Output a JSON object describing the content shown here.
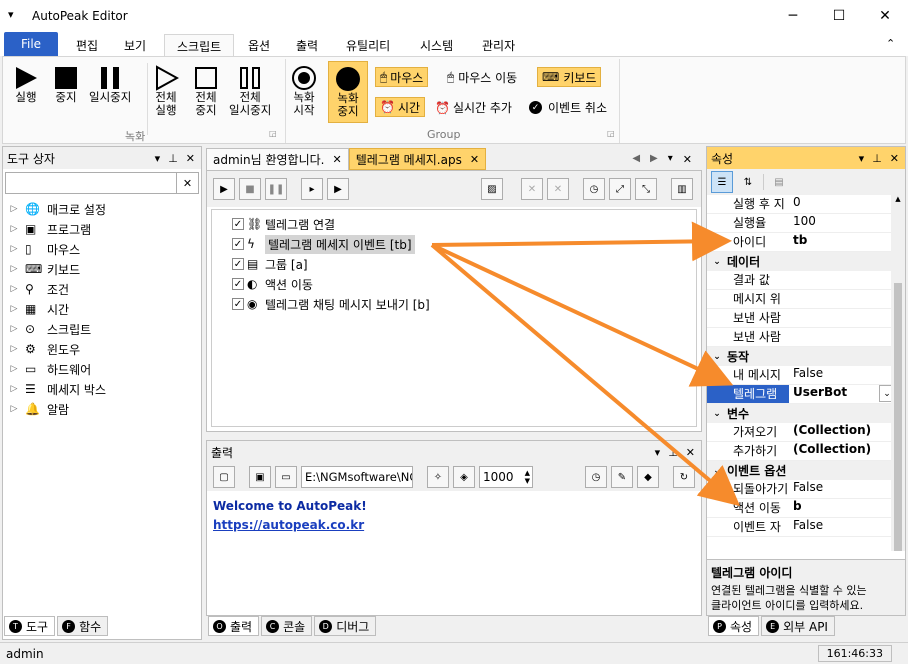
{
  "app": {
    "title": "AutoPeak Editor"
  },
  "menu": {
    "file": "File",
    "tabs": [
      "편집",
      "보기",
      "스크립트",
      "옵션",
      "출력",
      "유틸리티",
      "시스템",
      "관리자"
    ]
  },
  "ribbon": {
    "run": "실행",
    "stop": "중지",
    "pause": "일시중지",
    "full_run_1": "전체",
    "full_run_2": "실행",
    "full_stop_1": "전체",
    "full_stop_2": "중지",
    "full_pause_1": "전체",
    "full_pause_2": "일시중지",
    "group1": "녹화",
    "rec_start_1": "녹화",
    "rec_start_2": "시작",
    "rec_stop_1": "녹화",
    "rec_stop_2": "중지",
    "mouse": "마우스",
    "mouse_move": "마우스 이동",
    "keyboard": "키보드",
    "time": "시간",
    "realtime_add": "실시간 추가",
    "event_cancel": "이벤트 취소",
    "group2": "Group"
  },
  "toolbox": {
    "title": "도구 상자",
    "items": [
      "매크로 설정",
      "프로그램",
      "마우스",
      "키보드",
      "조건",
      "시간",
      "스크립트",
      "윈도우",
      "하드웨어",
      "메세지 박스",
      "알람"
    ],
    "tab_tool": "도구",
    "tab_func": "함수",
    "tab_tool_key": "T",
    "tab_func_key": "F"
  },
  "editor": {
    "tab1": "admin님 환영합니다.",
    "tab2": "텔레그램 메세지.aps",
    "items": [
      {
        "label": "텔레그램 연결",
        "icon": "link-icon"
      },
      {
        "label": "텔레그램 메세지 이벤트 [tb]",
        "icon": "lightning-icon"
      },
      {
        "label": "그룹 [a]",
        "icon": "group-icon"
      },
      {
        "label": "액션 이동",
        "icon": "action-icon"
      },
      {
        "label": "텔레그램 채팅 메시지 보내기 [b]",
        "icon": "telegram-icon"
      }
    ]
  },
  "output": {
    "title": "출력",
    "path": "E:\\NGMsoftware\\NG",
    "count": "1000",
    "line1": "Welcome to AutoPeak!",
    "line2": "https://autopeak.co.kr",
    "tab_out": "출력",
    "tab_console": "콘솔",
    "tab_debug": "디버그",
    "key_out": "O",
    "key_console": "C",
    "key_debug": "D"
  },
  "properties": {
    "title": "속성",
    "rows_top": [
      {
        "name": "실행 후 지",
        "value": "0"
      },
      {
        "name": "실행율",
        "value": "100"
      },
      {
        "name": "아이디",
        "value": "tb"
      }
    ],
    "cat_data": "데이터",
    "rows_data": [
      {
        "name": "결과 값",
        "value": ""
      },
      {
        "name": "메시지 위",
        "value": ""
      },
      {
        "name": "보낸 사람",
        "value": ""
      },
      {
        "name": "보낸 사람",
        "value": ""
      }
    ],
    "cat_action": "동작",
    "row_my": {
      "name": "내 메시지",
      "value": "False"
    },
    "row_tg": {
      "name": "텔레그램",
      "value": "UserBot"
    },
    "cat_var": "변수",
    "rows_var": [
      {
        "name": "가져오기",
        "value": "(Collection)"
      },
      {
        "name": "추가하기",
        "value": "(Collection)"
      }
    ],
    "cat_event": "이벤트 옵션",
    "rows_event": [
      {
        "name": "되돌아가기",
        "value": "False"
      },
      {
        "name": "액션 이동",
        "value": "b"
      },
      {
        "name": "이벤트 자",
        "value": "False"
      }
    ],
    "desc_title": "텔레그램 아이디",
    "desc_text1": "연결된 텔레그램을 식별할 수 있는",
    "desc_text2": "클라이언트 아이디를 입력하세요.",
    "tab_prop": "속성",
    "tab_api": "외부 API",
    "key_prop": "P",
    "key_api": "E"
  },
  "status": {
    "user": "admin",
    "time": "161:46:33"
  },
  "colors": {
    "accent": "#2b61c7",
    "highlight": "#ffd36b",
    "arrow": "#f68b2c"
  }
}
